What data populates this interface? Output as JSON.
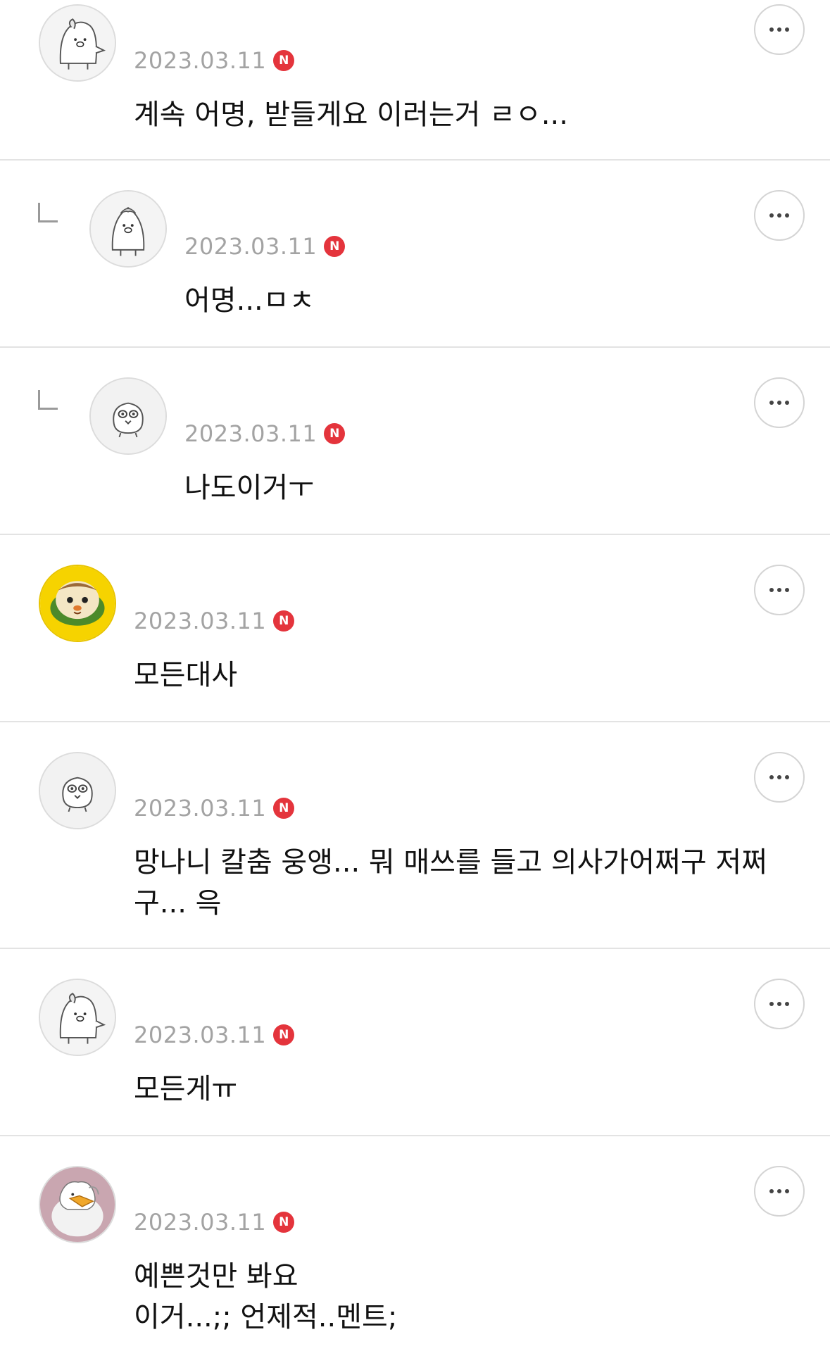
{
  "colors": {
    "date": "#a3a3a3",
    "new_badge": "#e4343c",
    "divider": "#e3e3e3",
    "text": "#111111"
  },
  "comments": [
    {
      "date": "2023.03.11",
      "badge": "N",
      "text": "계속 어명, 받들게요 이러는거 ㄹㅇ...",
      "reply": false,
      "avatar": "white-penguin-avatar-icon",
      "more": "more-options-icon"
    },
    {
      "date": "2023.03.11",
      "badge": "N",
      "text": "어명...ㅁㅊ",
      "reply": true,
      "avatar": "white-penguin-avatar-icon",
      "more": "more-options-icon"
    },
    {
      "date": "2023.03.11",
      "badge": "N",
      "text": "나도이거ㅜ",
      "reply": true,
      "avatar": "blob-character-avatar-icon",
      "more": "more-options-icon"
    },
    {
      "date": "2023.03.11",
      "badge": "N",
      "text": "모든대사",
      "reply": false,
      "avatar": "guinea-pig-car-avatar-icon",
      "more": "more-options-icon"
    },
    {
      "date": "2023.03.11",
      "badge": "N",
      "text": "망나니 칼춤 웅앵... 뭐 매쓰를 들고 의사가어쩌구 저쩌구... 윽",
      "reply": false,
      "avatar": "blob-character-avatar-icon",
      "more": "more-options-icon"
    },
    {
      "date": "2023.03.11",
      "badge": "N",
      "text": "모든게ㅠ",
      "reply": false,
      "avatar": "white-penguin-avatar-icon",
      "more": "more-options-icon"
    },
    {
      "date": "2023.03.11",
      "badge": "N",
      "text": "예쁜것만 봐요\n이거...;; 언제적..멘트;",
      "reply": false,
      "avatar": "duck-character-avatar-icon",
      "more": "more-options-icon"
    }
  ]
}
